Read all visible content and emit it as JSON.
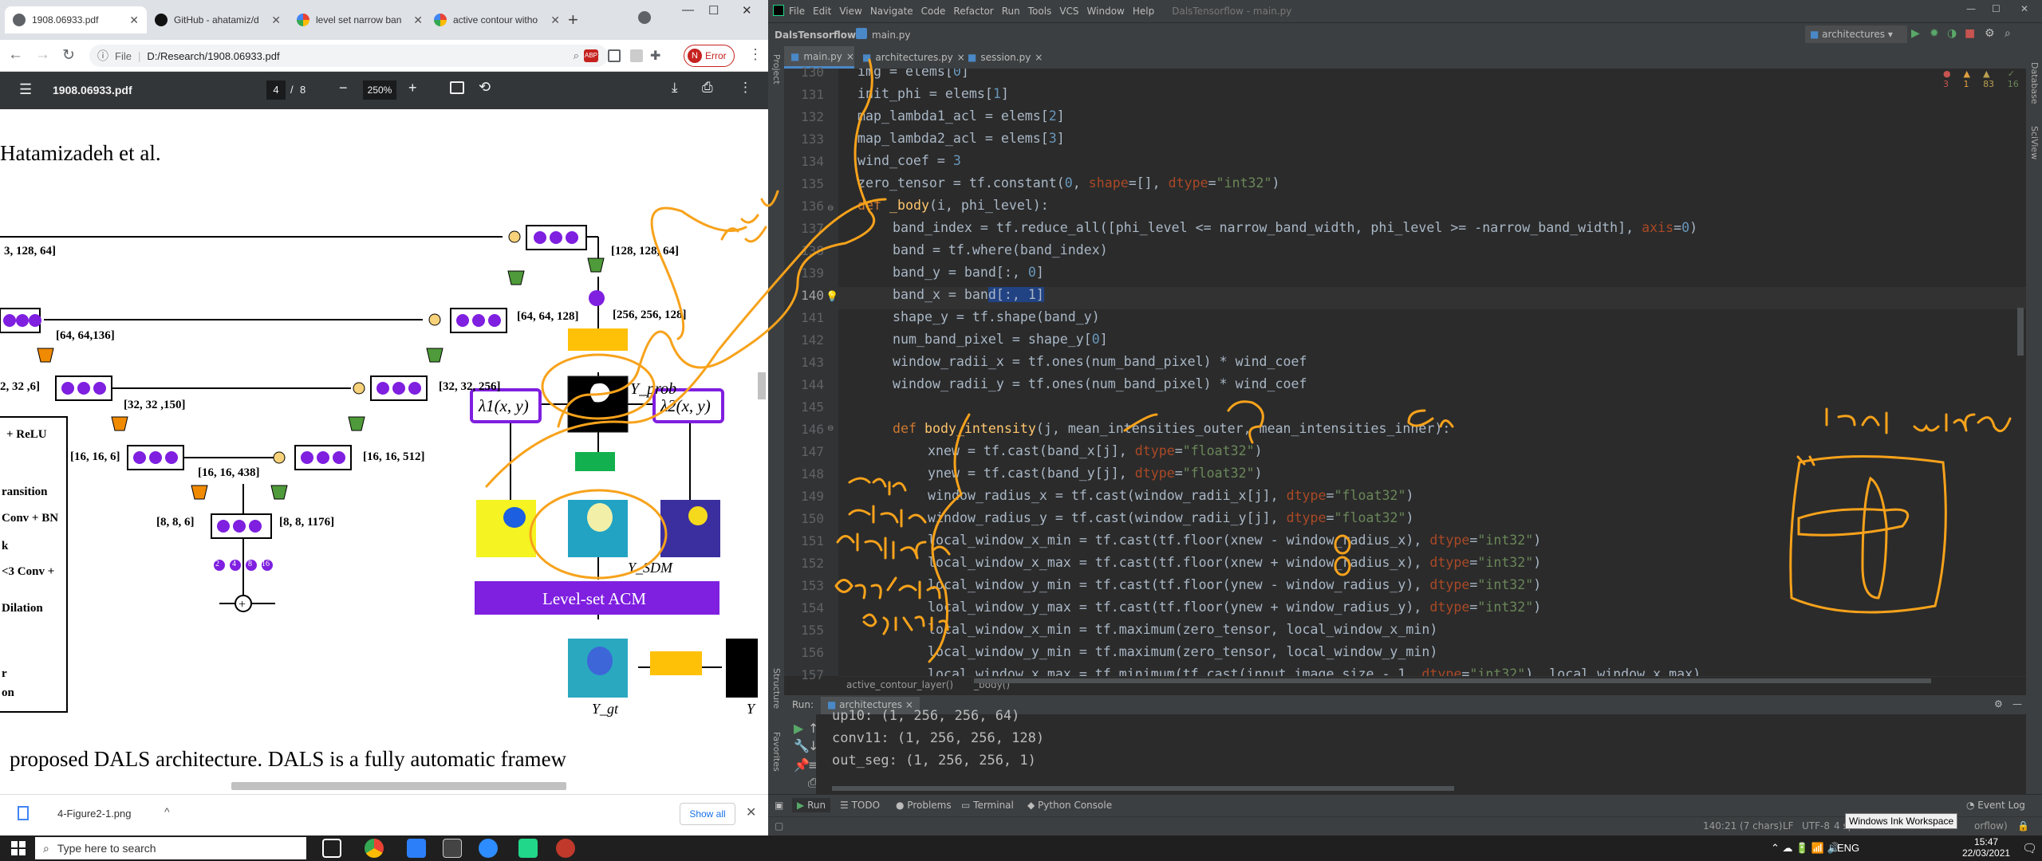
{
  "browser": {
    "tabs": [
      {
        "title": "1908.06933.pdf"
      },
      {
        "title": "GitHub - ahatamiz/d"
      },
      {
        "title": "level set narrow ban"
      },
      {
        "title": "active contour witho"
      }
    ],
    "new_tab": "+",
    "address": {
      "scheme": "File",
      "path": "D:/Research/1908.06933.pdf"
    },
    "profile_initial": "N",
    "error_label": "Error",
    "pdf": {
      "filename": "1908.06933.pdf",
      "page_current": "4",
      "page_sep": "/",
      "page_total": "8",
      "zoom": "250%"
    },
    "download": {
      "filename": "4-Figure2-1.png",
      "show_all": "Show all"
    }
  },
  "figure": {
    "header": "Hatamizadeh et al.",
    "dims": [
      "3, 128, 64]",
      "[128, 128, 64]",
      "[64, 64,136]",
      "[256, 256, 128]",
      "[64, 64, 128]",
      "2, 32 ,6]",
      "[32, 32 ,150]",
      "[32, 32, 256]",
      "[16, 16, 6]",
      "[16, 16, 438]",
      "[16, 16, 512]",
      "[8, 8, 6]",
      "[8, 8, 1176]"
    ],
    "legend": [
      "+ ReLU",
      "ransition",
      "Conv + BN",
      "k",
      "<3 Conv +",
      "Dilation",
      "r",
      "on"
    ],
    "y_prob": "Y_prob",
    "lambda1": "λ1(x, y)",
    "lambda2": "λ2(x, y)",
    "y_sdm": "Y_SDM",
    "acm": "Level-set ACM",
    "y_gt": "Y_gt",
    "y_cut": "Y",
    "caption": "proposed DALS architecture. DALS is a fully automatic framew",
    "dot_nums": [
      "2",
      "4",
      "8",
      "16"
    ]
  },
  "ide": {
    "menu": [
      "File",
      "Edit",
      "View",
      "Navigate",
      "Code",
      "Refactor",
      "Run",
      "Tools",
      "VCS",
      "Window",
      "Help"
    ],
    "window_title": "DalsTensorflow - main.py",
    "project": "DalsTensorflow",
    "nav_file": "main.py",
    "run_config": "architectures",
    "tabs": [
      "main.py",
      "architectures.py",
      "session.py"
    ],
    "inspections": {
      "errors": "3",
      "warn1": "1",
      "warn2": "83",
      "weak": "16"
    },
    "line_numbers": [
      "130",
      "131",
      "132",
      "133",
      "134",
      "135",
      "136",
      "137",
      "138",
      "139",
      "140",
      "141",
      "142",
      "143",
      "144",
      "145",
      "146",
      "147",
      "148",
      "149",
      "150",
      "151",
      "152",
      "153",
      "154",
      "155",
      "156",
      "157"
    ],
    "breadcrumb": [
      "active_contour_layer()",
      "_body()"
    ],
    "run_tab": "architectures",
    "run_label": "Run:",
    "output": [
      "up10: (1, 256, 256, 64)",
      "conv11: (1, 256, 256, 128)",
      "out_seg: (1, 256, 256, 1)"
    ],
    "tool_tabs": [
      "Run",
      "TODO",
      "Problems",
      "Terminal",
      "Python Console"
    ],
    "event_log": "Event Log",
    "status": {
      "pos": "140:21 (7 chars)",
      "le": "LF",
      "enc": "UTF-8",
      "indent": "4 sp",
      "interp": "orflow)"
    },
    "side_labels": {
      "project": "Project",
      "structure": "Structure",
      "favorites": "Favorites",
      "database": "Database",
      "sciview": "SciView"
    }
  },
  "annotations": {
    "sigmoid": "sigmoid",
    "each_pixel": "each pixel",
    "flattened": "flattened",
    "add_sub": "add/sub 3 pixels",
    "c2": "c2",
    "c1": "c1",
    "local_window": "local window"
  },
  "taskbar": {
    "search_placeholder": "Type here to search",
    "lang": "ENG",
    "time": "15:47",
    "date": "22/03/2021",
    "tooltip": "Windows Ink Workspace"
  },
  "colors": {
    "ink": "#f7a21b",
    "editor_bg": "#2b2b2b",
    "taskbar_accent": "#7fb341",
    "acm_purple": "#7f1fe0"
  }
}
